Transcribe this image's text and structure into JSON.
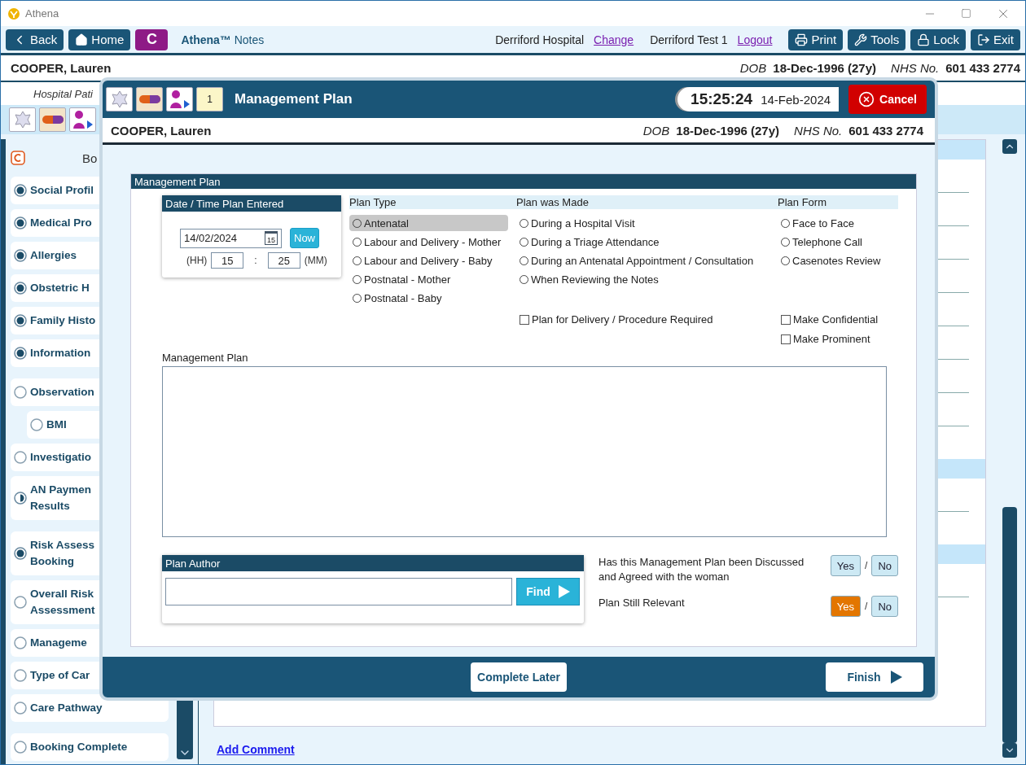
{
  "window": {
    "title": "Athena"
  },
  "toolbar": {
    "back": "Back",
    "home": "Home",
    "module": "C",
    "app_name": "**Athena™** Notes",
    "hospital": "Derriford Hospital",
    "change_link": "Change",
    "user": "Derriford Test 1",
    "logout_link": "Logout",
    "buttons": [
      {
        "kind": "print",
        "label": "Print"
      },
      {
        "kind": "tools",
        "label": "Tools"
      },
      {
        "kind": "lock",
        "label": "Lock"
      },
      {
        "kind": "exit",
        "label": "Exit"
      }
    ]
  },
  "patient": {
    "name": "COOPER, Lauren",
    "dob_label": "DOB",
    "dob": "18-Dec-1996 (27y)",
    "nhs_label": "NHS No.",
    "nhs": "601 433 2774"
  },
  "subheader": "Hospital Pati",
  "sidebar": {
    "header": "Bo",
    "items": [
      {
        "lines": [
          "Social Profil"
        ],
        "completed": true,
        "partial": false
      },
      {
        "lines": [
          "Medical Pro"
        ],
        "completed": true,
        "partial": false
      },
      {
        "lines": [
          "Allergies"
        ],
        "completed": true,
        "partial": false
      },
      {
        "lines": [
          "Obstetric H"
        ],
        "completed": true,
        "partial": false
      },
      {
        "lines": [
          "Family Histo"
        ],
        "completed": true,
        "partial": false
      },
      {
        "lines": [
          "Information"
        ],
        "completed": true,
        "partial": false
      },
      {
        "lines": [
          "Observation"
        ],
        "completed": false,
        "partial": false,
        "children": [
          {
            "lines": [
              "BMI"
            ],
            "completed": false,
            "partial": false
          }
        ]
      },
      {
        "lines": [
          "Investigatio"
        ],
        "completed": false,
        "partial": false
      },
      {
        "lines": [
          "AN Paymen",
          "Results"
        ],
        "completed": false,
        "partial": true
      },
      {
        "lines": [
          "Risk Assess",
          "Booking"
        ],
        "completed": true,
        "partial": false
      },
      {
        "lines": [
          "Overall Risk",
          "Assessment"
        ],
        "completed": false,
        "partial": false
      },
      {
        "lines": [
          "Manageme"
        ],
        "completed": false,
        "partial": false
      },
      {
        "lines": [
          "Type of Car"
        ],
        "completed": false,
        "partial": false
      },
      {
        "lines": [
          "Care Pathway"
        ],
        "completed": false,
        "partial": false
      },
      {
        "lines": [
          "Booking Complete"
        ],
        "completed": false,
        "partial": false
      }
    ]
  },
  "main": {
    "add_comment": "Add Comment"
  },
  "modal": {
    "title": "Management Plan",
    "notepad_count": "1",
    "time": "15:25:24",
    "date": "14-Feb-2024",
    "cancel": "Cancel",
    "patient": {
      "name": "COOPER, Lauren",
      "dob_label": "DOB",
      "dob": "18-Dec-1996 (27y)",
      "nhs_label": "NHS No.",
      "nhs": "601 433 2774"
    },
    "section_title": "Management Plan",
    "date_panel": {
      "title": "Date / Time Plan Entered",
      "date": "14/02/2024",
      "calendar_day": "15",
      "now": "Now",
      "hh_label": "(HH)",
      "hh": "15",
      "separator": ":",
      "mm": "25",
      "mm_label": "(MM)"
    },
    "columns": [
      {
        "title": "Plan Type",
        "options": [
          {
            "label": "Antenatal",
            "selected": false,
            "highlighted": true
          },
          {
            "label": "Labour and Delivery - Mother",
            "selected": false,
            "highlighted": false
          },
          {
            "label": "Labour and Delivery - Baby",
            "selected": false,
            "highlighted": false
          },
          {
            "label": "Postnatal - Mother",
            "selected": false,
            "highlighted": false
          },
          {
            "label": "Postnatal - Baby",
            "selected": false,
            "highlighted": false
          }
        ]
      },
      {
        "title": "Plan was Made",
        "options": [
          {
            "label": "During a Hospital Visit",
            "selected": false,
            "highlighted": false
          },
          {
            "label": "During a Triage Attendance",
            "selected": false,
            "highlighted": false
          },
          {
            "label": "During an Antenatal Appointment / Consultation",
            "selected": false,
            "highlighted": false
          },
          {
            "label": "When Reviewing the Notes",
            "selected": false,
            "highlighted": false
          }
        ],
        "checkboxes": [
          {
            "label": "Plan for Delivery / Procedure Required",
            "checked": false
          }
        ]
      },
      {
        "title": "Plan Form",
        "options": [
          {
            "label": "Face to Face",
            "selected": false,
            "highlighted": false
          },
          {
            "label": "Telephone Call",
            "selected": false,
            "highlighted": false
          },
          {
            "label": "Casenotes Review",
            "selected": false,
            "highlighted": false
          }
        ],
        "checkboxes": [
          {
            "label": "Make Confidential",
            "checked": false
          },
          {
            "label": "Make Prominent",
            "checked": false
          }
        ]
      }
    ],
    "notes_label": "Management Plan",
    "author": {
      "title": "Plan Author",
      "find": "Find"
    },
    "questions": [
      {
        "text": "Has this Management Plan been Discussed and Agreed with the woman",
        "separator": "/",
        "options": [
          {
            "label": "Yes",
            "selected": false
          },
          {
            "label": "No",
            "selected": false
          }
        ]
      },
      {
        "text": "Plan Still Relevant",
        "separator": "/",
        "options": [
          {
            "label": "Yes",
            "selected": true
          },
          {
            "label": "No",
            "selected": false
          }
        ]
      }
    ],
    "complete_later": "Complete Later",
    "finish": "Finish"
  }
}
